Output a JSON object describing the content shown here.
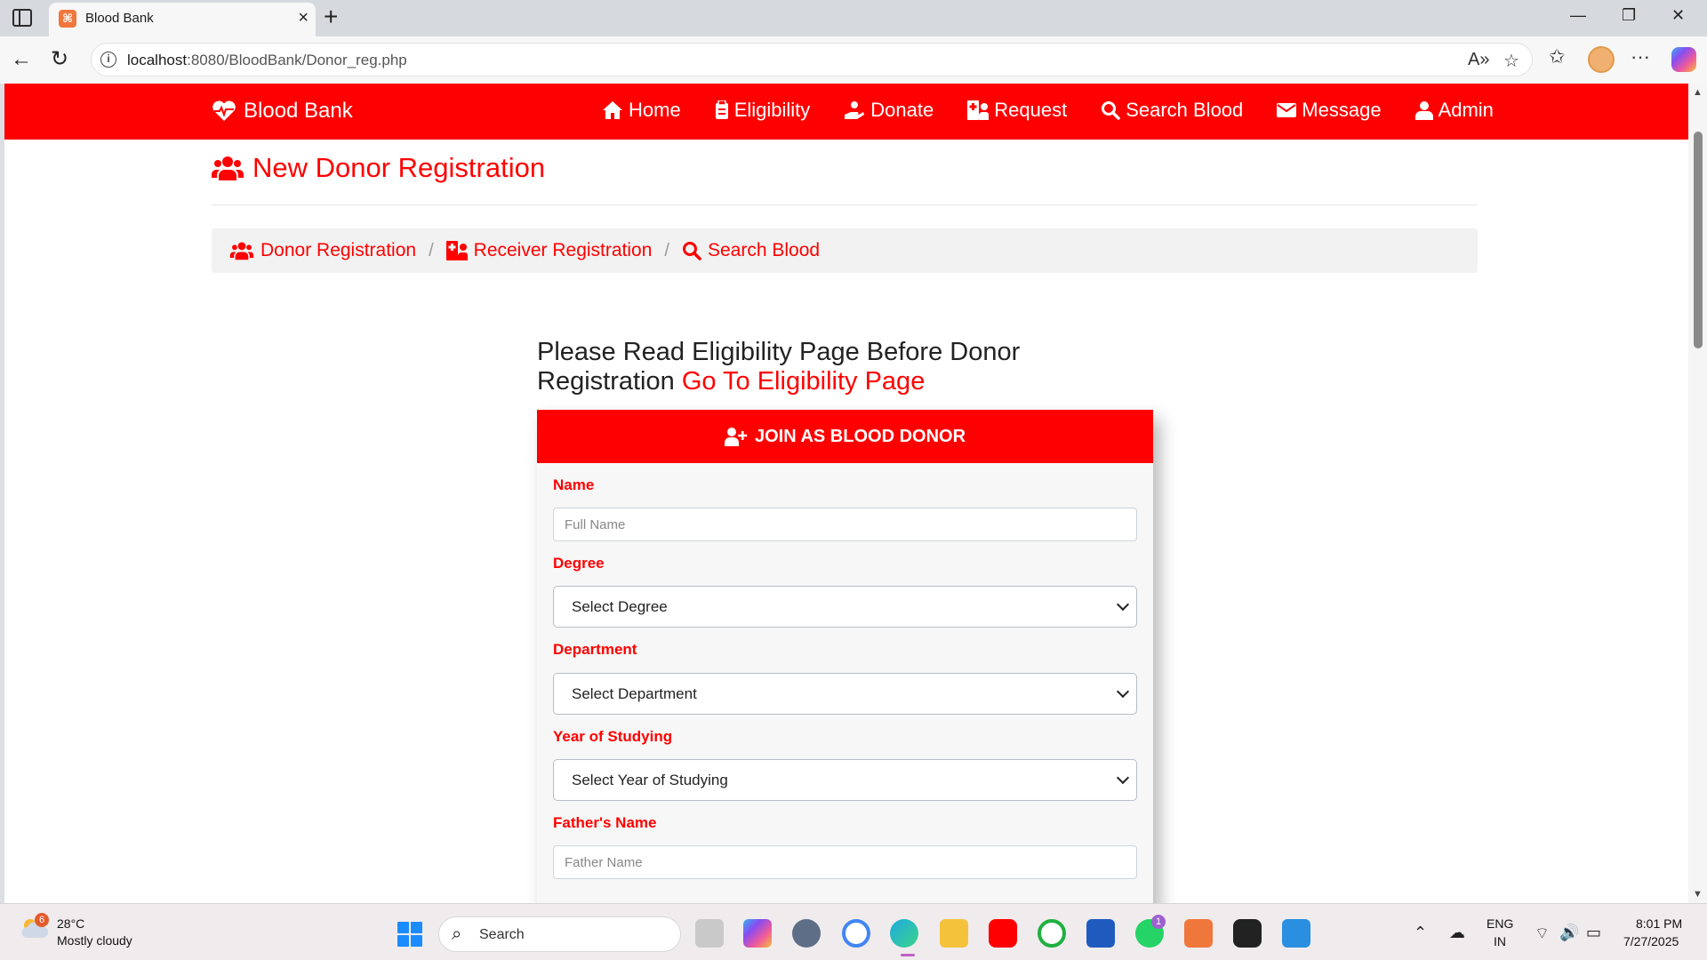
{
  "browser": {
    "tab_title": "Blood Bank",
    "url_host": "localhost",
    "url_path": ":8080/BloodBank/Donor_reg.php"
  },
  "navbar": {
    "brand": "Blood Bank",
    "items": [
      {
        "label": "Home",
        "icon": "home-icon"
      },
      {
        "label": "Eligibility",
        "icon": "clipboard-icon"
      },
      {
        "label": "Donate",
        "icon": "hand-holding-icon"
      },
      {
        "label": "Request",
        "icon": "hospital-user-icon"
      },
      {
        "label": "Search Blood",
        "icon": "search-icon"
      },
      {
        "label": "Message",
        "icon": "envelope-icon"
      },
      {
        "label": "Admin",
        "icon": "user-icon"
      }
    ]
  },
  "page": {
    "title": "New Donor Registration",
    "breadcrumb": [
      {
        "label": "Donor Registration",
        "icon": "users-icon"
      },
      {
        "label": "Receiver Registration",
        "icon": "hospital-user-icon"
      },
      {
        "label": "Search Blood",
        "icon": "search-icon"
      }
    ],
    "notice_text": "Please Read Eligibility Page Before Donor Registration",
    "notice_link": "Go To Eligibility Page"
  },
  "form": {
    "header": "JOIN AS BLOOD DONOR",
    "name_label": "Name",
    "name_placeholder": "Full Name",
    "degree_label": "Degree",
    "degree_value": "Select Degree",
    "department_label": "Department",
    "department_value": "Select Department",
    "year_label": "Year of Studying",
    "year_value": "Select Year of Studying",
    "father_label": "Father's Name",
    "father_placeholder": "Father Name"
  },
  "taskbar": {
    "weather_badge": "6",
    "weather_temp": "28°C",
    "weather_desc": "Mostly cloudy",
    "search_label": "Search",
    "whatsapp_badge": "1",
    "lang_top": "ENG",
    "lang_bottom": "IN",
    "time": "8:01 PM",
    "date": "7/27/2025"
  }
}
